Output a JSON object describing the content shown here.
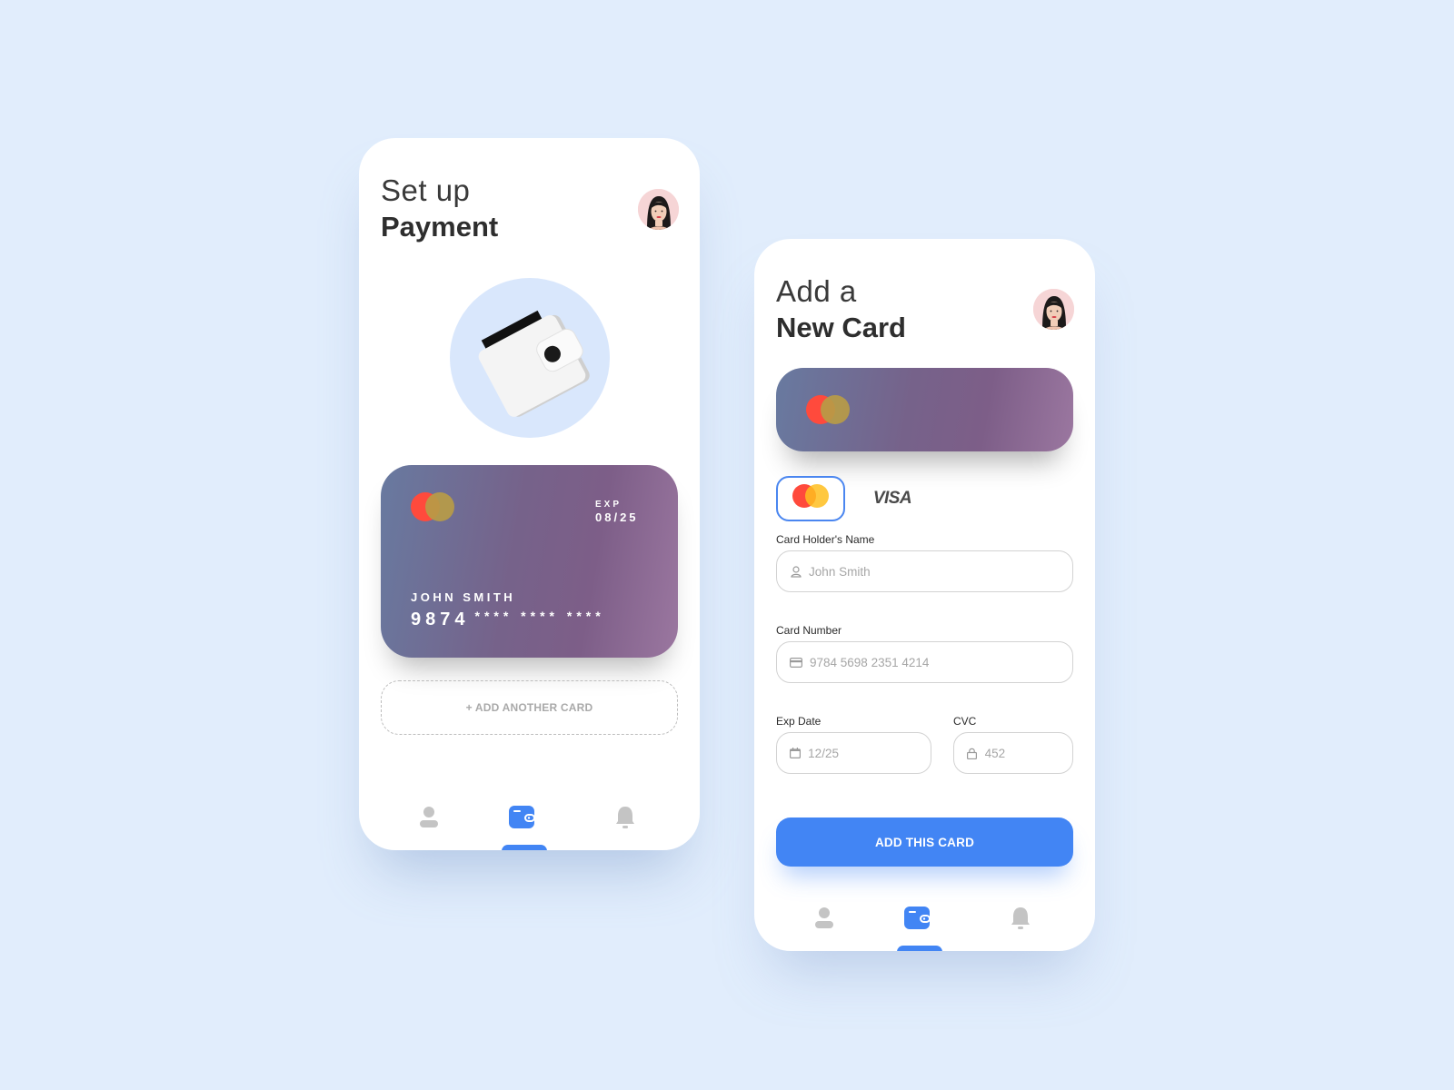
{
  "colors": {
    "background": "#e1edfc",
    "accent": "#4285f4",
    "card_gradient_start": "#687aa0",
    "card_gradient_end": "#9b77a0",
    "mastercard_red": "#ff4a3c",
    "mastercard_yellow": "#ffbe1e",
    "inactive_icon": "#c4c4c4"
  },
  "setup_screen": {
    "title_light": "Set up",
    "title_bold": "Payment",
    "avatar": "user-avatar",
    "illustration": "wallet-illustration",
    "card": {
      "brand": "mastercard",
      "exp_label": "EXP",
      "exp_value": "08/25",
      "holder_name": "JOHN SMITH",
      "number_visible": "9874",
      "number_masked": "**** **** ****"
    },
    "add_another_label": "+ ADD ANOTHER CARD",
    "nav": [
      {
        "icon": "user-icon",
        "active": false
      },
      {
        "icon": "wallet-icon",
        "active": true
      },
      {
        "icon": "bell-icon",
        "active": false
      }
    ]
  },
  "add_card_screen": {
    "title_light": "Add a",
    "title_bold": "New Card",
    "avatar": "user-avatar",
    "card_preview_brand": "mastercard",
    "brand_options": [
      {
        "name": "mastercard",
        "selected": true
      },
      {
        "name": "VISA",
        "selected": false
      }
    ],
    "fields": {
      "holder": {
        "label": "Card Holder's Name",
        "placeholder": "John Smith",
        "icon": "user-icon"
      },
      "number": {
        "label": "Card Number",
        "placeholder": "9784 5698 2351 4214",
        "icon": "credit-card-icon"
      },
      "exp": {
        "label": "Exp Date",
        "placeholder": "12/25",
        "icon": "calendar-icon"
      },
      "cvc": {
        "label": "CVC",
        "placeholder": "452",
        "icon": "lock-icon"
      }
    },
    "submit_label": "ADD THIS CARD",
    "nav": [
      {
        "icon": "user-icon",
        "active": false
      },
      {
        "icon": "wallet-icon",
        "active": true
      },
      {
        "icon": "bell-icon",
        "active": false
      }
    ]
  }
}
